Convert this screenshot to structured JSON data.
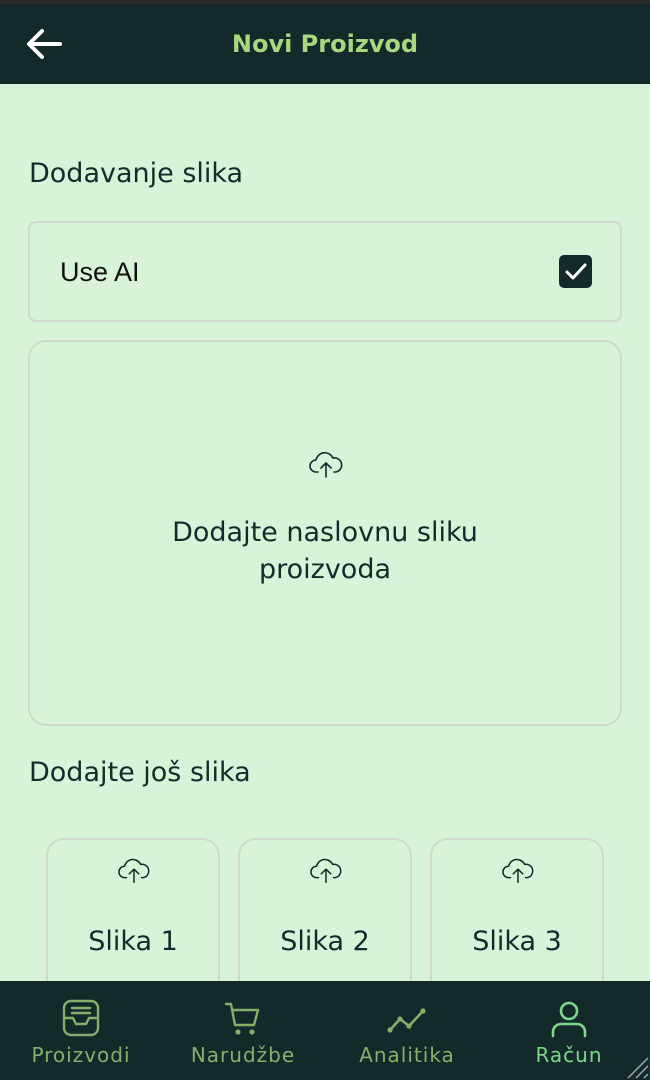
{
  "header": {
    "title": "Novi Proizvod"
  },
  "section1": {
    "title": "Dodavanje slika"
  },
  "ai_toggle": {
    "label": "Use AI",
    "checked": true
  },
  "cover_upload": {
    "text": "Dodajte naslovnu sliku proizvoda"
  },
  "section2": {
    "title": "Dodajte još slika"
  },
  "thumbs": [
    {
      "label": "Slika 1"
    },
    {
      "label": "Slika 2"
    },
    {
      "label": "Slika 3"
    }
  ],
  "nav": {
    "items": [
      {
        "label": "Proizvodi",
        "icon": "inbox-icon"
      },
      {
        "label": "Narudžbe",
        "icon": "cart-icon"
      },
      {
        "label": "Analitika",
        "icon": "chart-line-icon"
      },
      {
        "label": "Račun",
        "icon": "user-icon",
        "active": true
      }
    ]
  },
  "colors": {
    "background": "#d8f3d7",
    "header": "#142a2a",
    "accent": "#a9d77f",
    "nav_text": "#84b06c",
    "nav_active": "#7dd88a"
  }
}
